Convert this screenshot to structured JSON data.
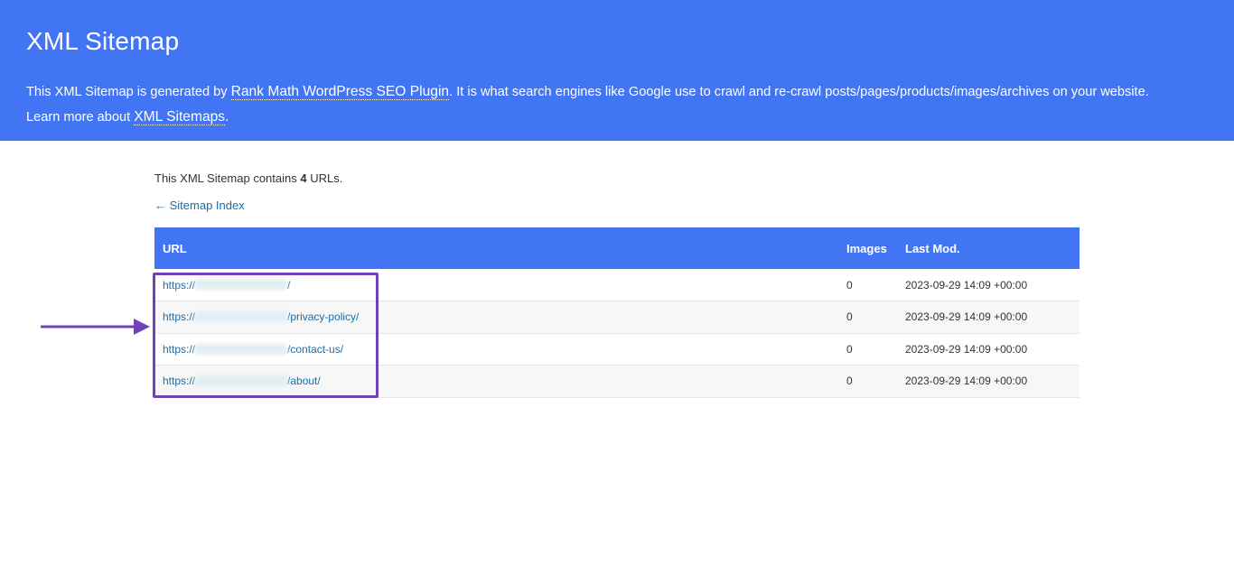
{
  "header": {
    "title": "XML Sitemap",
    "desc_prefix": "This XML Sitemap is generated by ",
    "plugin_link": "Rank Math WordPress SEO Plugin",
    "desc_middle": ". It is what search engines like Google use to crawl and re-crawl posts/pages/products/images/archives on your website.",
    "learn_prefix": "Learn more about ",
    "learn_link": "XML Sitemaps",
    "learn_suffix": "."
  },
  "summary": {
    "prefix": "This XML Sitemap contains ",
    "count": "4",
    "suffix": " URLs."
  },
  "back_link": "← Sitemap Index",
  "table": {
    "headers": [
      "URL",
      "Images",
      "Last Mod."
    ],
    "rows": [
      {
        "url_prefix": "https://",
        "url_path": "/",
        "images": "0",
        "lastmod": "2023-09-29 14:09 +00:00"
      },
      {
        "url_prefix": "https://",
        "url_path": "/privacy-policy/",
        "images": "0",
        "lastmod": "2023-09-29 14:09 +00:00"
      },
      {
        "url_prefix": "https://",
        "url_path": "/contact-us/",
        "images": "0",
        "lastmod": "2023-09-29 14:09 +00:00"
      },
      {
        "url_prefix": "https://",
        "url_path": "/about/",
        "images": "0",
        "lastmod": "2023-09-29 14:09 +00:00"
      }
    ]
  },
  "colors": {
    "header_bg": "#4275f4",
    "link": "#1a6da8",
    "annotation": "#6f43b5"
  }
}
